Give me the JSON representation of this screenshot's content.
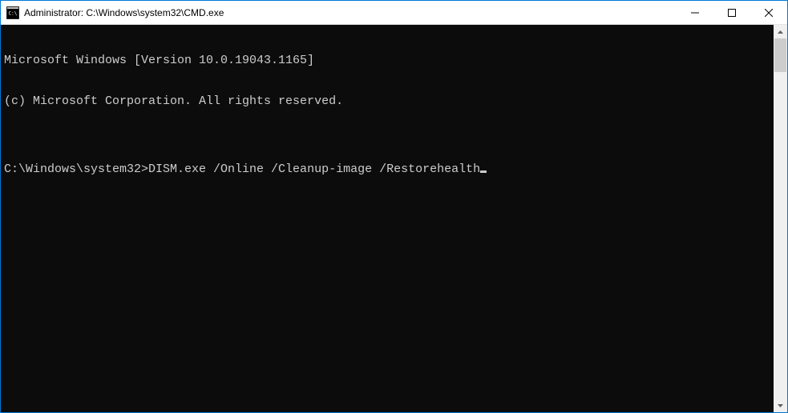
{
  "titlebar": {
    "title": "Administrator: C:\\Windows\\system32\\CMD.exe"
  },
  "terminal": {
    "line1": "Microsoft Windows [Version 10.0.19043.1165]",
    "line2": "(c) Microsoft Corporation. All rights reserved.",
    "line3": "",
    "prompt": "C:\\Windows\\system32>",
    "command": "DISM.exe /Online /Cleanup-image /Restorehealth"
  }
}
